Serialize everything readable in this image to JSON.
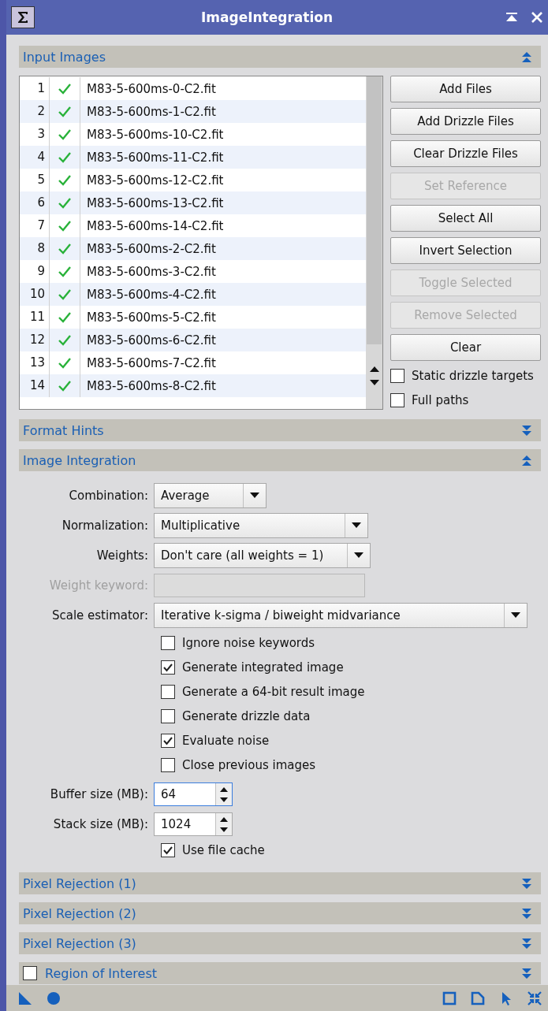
{
  "window": {
    "title": "ImageIntegration"
  },
  "input_images": {
    "title": "Input Images",
    "expanded": true,
    "files": [
      {
        "index": "1",
        "enabled": true,
        "name": "M83-5-600ms-0-C2.fit"
      },
      {
        "index": "2",
        "enabled": true,
        "name": "M83-5-600ms-1-C2.fit"
      },
      {
        "index": "3",
        "enabled": true,
        "name": "M83-5-600ms-10-C2.fit"
      },
      {
        "index": "4",
        "enabled": true,
        "name": "M83-5-600ms-11-C2.fit"
      },
      {
        "index": "5",
        "enabled": true,
        "name": "M83-5-600ms-12-C2.fit"
      },
      {
        "index": "6",
        "enabled": true,
        "name": "M83-5-600ms-13-C2.fit"
      },
      {
        "index": "7",
        "enabled": true,
        "name": "M83-5-600ms-14-C2.fit"
      },
      {
        "index": "8",
        "enabled": true,
        "name": "M83-5-600ms-2-C2.fit"
      },
      {
        "index": "9",
        "enabled": true,
        "name": "M83-5-600ms-3-C2.fit"
      },
      {
        "index": "10",
        "enabled": true,
        "name": "M83-5-600ms-4-C2.fit"
      },
      {
        "index": "11",
        "enabled": true,
        "name": "M83-5-600ms-5-C2.fit"
      },
      {
        "index": "12",
        "enabled": true,
        "name": "M83-5-600ms-6-C2.fit"
      },
      {
        "index": "13",
        "enabled": true,
        "name": "M83-5-600ms-7-C2.fit"
      },
      {
        "index": "14",
        "enabled": true,
        "name": "M83-5-600ms-8-C2.fit"
      }
    ],
    "buttons": [
      {
        "label": "Add Files",
        "disabled": false
      },
      {
        "label": "Add Drizzle Files",
        "disabled": false
      },
      {
        "label": "Clear Drizzle Files",
        "disabled": false
      },
      {
        "label": "Set Reference",
        "disabled": true
      },
      {
        "label": "Select All",
        "disabled": false
      },
      {
        "label": "Invert Selection",
        "disabled": false
      },
      {
        "label": "Toggle Selected",
        "disabled": true
      },
      {
        "label": "Remove Selected",
        "disabled": true
      },
      {
        "label": "Clear",
        "disabled": false
      }
    ],
    "options": [
      {
        "label": "Static drizzle targets",
        "checked": false
      },
      {
        "label": "Full paths",
        "checked": false
      }
    ]
  },
  "format_hints": {
    "title": "Format Hints",
    "expanded": false
  },
  "image_integration": {
    "title": "Image Integration",
    "expanded": true,
    "fields": [
      {
        "kind": "combo",
        "label": "Combination:",
        "value": "Average",
        "disabled": false
      },
      {
        "kind": "combo",
        "label": "Normalization:",
        "value": "Multiplicative",
        "disabled": false
      },
      {
        "kind": "combo",
        "label": "Weights:",
        "value": "Don't care (all weights = 1)",
        "disabled": false
      },
      {
        "kind": "text",
        "label": "Weight keyword:",
        "disabled": true
      },
      {
        "kind": "combo",
        "label": "Scale estimator:",
        "value": "Iterative k-sigma / biweight midvariance",
        "disabled": false
      }
    ],
    "options": [
      {
        "label": "Ignore noise keywords",
        "checked": false
      },
      {
        "label": "Generate integrated image",
        "checked": true
      },
      {
        "label": "Generate a 64-bit result image",
        "checked": false
      },
      {
        "label": "Generate drizzle data",
        "checked": false
      },
      {
        "label": "Evaluate noise",
        "checked": true
      },
      {
        "label": "Close previous images",
        "checked": false
      }
    ],
    "spinners": [
      {
        "label": "Buffer size (MB):",
        "value": "64",
        "focused": true
      },
      {
        "label": "Stack size (MB):",
        "value": "1024",
        "focused": false
      }
    ],
    "cache_option": {
      "label": "Use file cache",
      "checked": true
    }
  },
  "collapsed_sections": [
    {
      "title": "Pixel Rejection (1)",
      "expanded": false
    },
    {
      "title": "Pixel Rejection (2)",
      "expanded": false
    },
    {
      "title": "Pixel Rejection (3)",
      "expanded": false
    },
    {
      "title": "Region of Interest",
      "expanded": false,
      "checked": false
    }
  ]
}
